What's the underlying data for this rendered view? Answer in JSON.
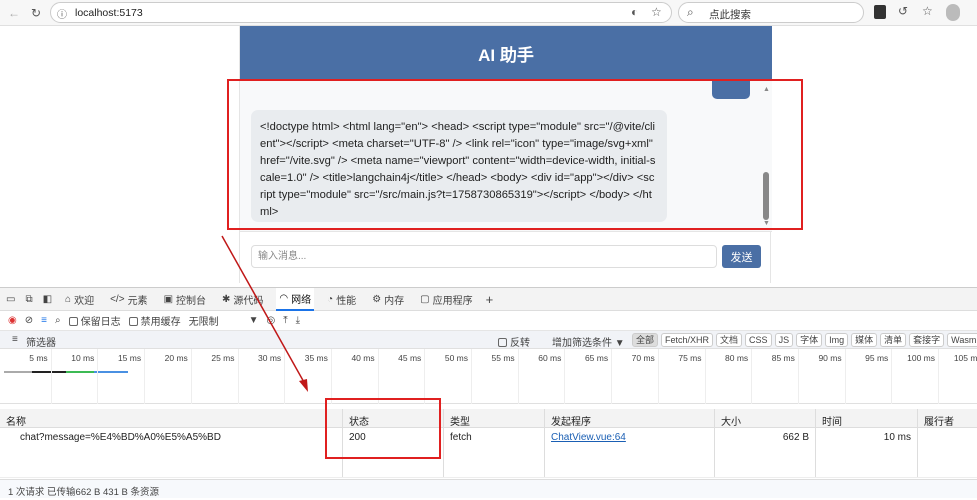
{
  "browser": {
    "url": "localhost:5173",
    "search_placeholder": "点此搜索"
  },
  "chat": {
    "title": "AI 助手",
    "assistant_message": "<!doctype html> <html lang=\"en\"> <head> <script type=\"module\" src=\"/@vite/client\"></script> <meta charset=\"UTF-8\" /> <link rel=\"icon\" type=\"image/svg+xml\" href=\"/vite.svg\" /> <meta name=\"viewport\" content=\"width=device-width, initial-scale=1.0\" /> <title>langchain4j</title> </head> <body> <div id=\"app\"></div> <script type=\"module\" src=\"/src/main.js?t=1758730865319\"></script> </body> </html>",
    "input_placeholder": "输入消息...",
    "send_label": "发送"
  },
  "devtools": {
    "tabs": [
      {
        "label": "欢迎",
        "icon": "home"
      },
      {
        "label": "元素",
        "icon": "code"
      },
      {
        "label": "控制台",
        "icon": "console"
      },
      {
        "label": "源代码",
        "icon": "bug"
      },
      {
        "label": "网络",
        "icon": "wifi",
        "active": true
      },
      {
        "label": "性能",
        "icon": "gauge"
      },
      {
        "label": "内存",
        "icon": "chip"
      },
      {
        "label": "应用程序",
        "icon": "window"
      }
    ],
    "toolbar": {
      "preserve_log": "保留日志",
      "disable_cache": "禁用缓存",
      "throttle": "无限制"
    },
    "filter": {
      "placeholder": "筛选器",
      "invert": "反转",
      "more_filters": "增加筛选条件",
      "types": [
        "全部",
        "Fetch/XHR",
        "文档",
        "CSS",
        "JS",
        "字体",
        "Img",
        "媒体",
        "清单",
        "套接字",
        "Wasm"
      ],
      "active_type": "全部"
    },
    "timeline_ticks": [
      "5 ms",
      "10 ms",
      "15 ms",
      "20 ms",
      "25 ms",
      "30 ms",
      "35 ms",
      "40 ms",
      "45 ms",
      "50 ms",
      "55 ms",
      "60 ms",
      "65 ms",
      "70 ms",
      "75 ms",
      "80 ms",
      "85 ms",
      "90 ms",
      "95 ms",
      "100 ms",
      "105 ms"
    ],
    "columns": [
      "名称",
      "状态",
      "类型",
      "发起程序",
      "大小",
      "时间",
      "履行者"
    ],
    "rows": [
      {
        "name": "chat?message=%E4%BD%A0%E5%A5%BD",
        "status": "200",
        "type": "fetch",
        "initiator": "ChatView.vue:64",
        "size": "662 B",
        "time": "10 ms",
        "fulfilled_by": ""
      }
    ],
    "summary": "1 次请求  已传输662 B  431 B 条资源"
  },
  "colors": {
    "brand": "#4a6fa5",
    "annotation": "#e02020",
    "active_tab": "#1a73e8"
  }
}
